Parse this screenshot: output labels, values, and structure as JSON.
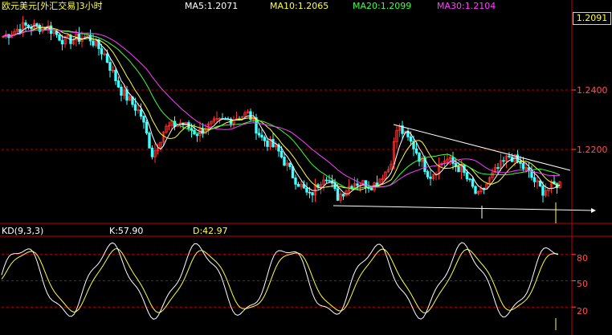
{
  "header": {
    "title": "欧元美元[外汇交易]3小时",
    "ma5": "MA5:1.2071",
    "ma10": "MA10:1.2065",
    "ma20": "MA20:1.2099",
    "ma30": "MA30:1.2104",
    "price_badge": "1.2091"
  },
  "kd_header": {
    "name": "KD(9,3,3)",
    "k": "K:57.90",
    "d": "D:42.97"
  },
  "colors": {
    "background": "#000000",
    "up_candle": "#ff3030",
    "down_candle": "#40ffff",
    "ma5": "#ffffff",
    "ma10": "#ffff40",
    "ma20": "#40ff40",
    "ma30": "#ff40ff",
    "grid": "#b00000",
    "axis_label": "#ff5050",
    "trendline": "#ffffff"
  },
  "chart_data": [
    {
      "type": "candlestick",
      "title": "欧元美元[外汇交易]3小时",
      "y_ticks": [
        "1.2400",
        "1.2200"
      ],
      "series": [
        {
          "name": "MA5",
          "value": 1.2071
        },
        {
          "name": "MA10",
          "value": 1.2065
        },
        {
          "name": "MA20",
          "value": 1.2099
        },
        {
          "name": "MA30",
          "value": 1.2104
        }
      ],
      "last_price": 1.2091,
      "grid": true
    },
    {
      "type": "line",
      "title": "KD(9,3,3)",
      "y_ticks": [
        "80",
        "50",
        "20"
      ],
      "series": [
        {
          "name": "K",
          "value": 57.9
        },
        {
          "name": "D",
          "value": 42.97
        }
      ],
      "grid": true
    }
  ]
}
